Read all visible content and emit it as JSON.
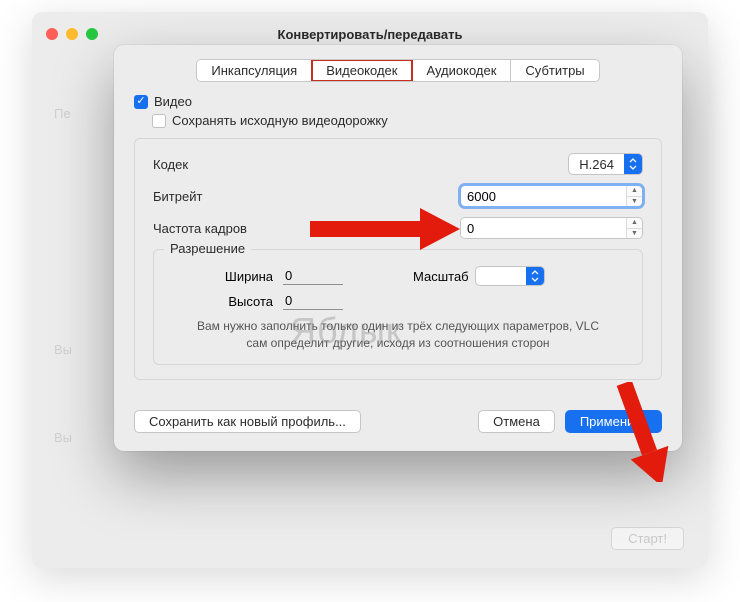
{
  "backdrop": {
    "title": "Конвертировать/передавать",
    "faint1": "Пе",
    "faint2": "Вы",
    "faint3": "Вы",
    "start_button": "Старт!"
  },
  "tabs": {
    "encapsulation": "Инкапсуляция",
    "videocodec": "Видеокодек",
    "audiocodec": "Аудиокодек",
    "subtitles": "Субтитры"
  },
  "checkboxes": {
    "video": "Видео",
    "keep_original": "Сохранять исходную видеодорожку"
  },
  "fields": {
    "codec_label": "Кодек",
    "codec_value": "H.264",
    "bitrate_label": "Битрейт",
    "bitrate_value": "6000",
    "framerate_label": "Частота кадров",
    "framerate_value": "0"
  },
  "resolution": {
    "legend": "Разрешение",
    "width_label": "Ширина",
    "width_value": "0",
    "height_label": "Высота",
    "height_value": "0",
    "scale_label": "Масштаб",
    "note": "Вам нужно заполнить только один из трёх следующих параметров, VLC сам определит другие, исходя из соотношения сторон"
  },
  "buttons": {
    "save_profile": "Сохранить как новый профиль...",
    "cancel": "Отмена",
    "apply": "Применить"
  },
  "watermark": "Яблык"
}
